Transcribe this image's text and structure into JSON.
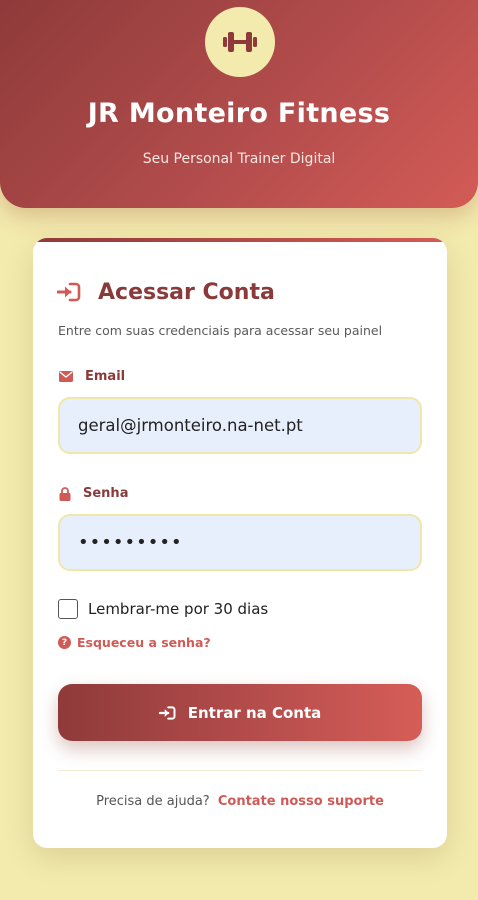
{
  "header": {
    "brand": "JR Monteiro Fitness",
    "tagline": "Seu Personal Trainer Digital",
    "logo_icon": "dumbbell-icon"
  },
  "login": {
    "title": "Acessar Conta",
    "title_icon": "sign-in-icon",
    "subtitle": "Entre com suas credenciais para acessar seu painel",
    "email": {
      "label": "Email",
      "icon": "envelope-icon",
      "value": "geral@jrmonteiro.na-net.pt"
    },
    "password": {
      "label": "Senha",
      "icon": "lock-icon",
      "value": "•••••••••"
    },
    "remember_label": "Lembrar-me por 30 dias",
    "remember_checked": false,
    "forgot_label": "Esqueceu a senha?",
    "submit_label": "Entrar na Conta",
    "help_text": "Precisa de ajuda?",
    "help_link": "Contate nosso suporte"
  },
  "colors": {
    "brand_dark": "#8f3a3a",
    "brand_light": "#d35b56",
    "page_bg": "#f3eaae",
    "input_bg": "#e8effc"
  }
}
